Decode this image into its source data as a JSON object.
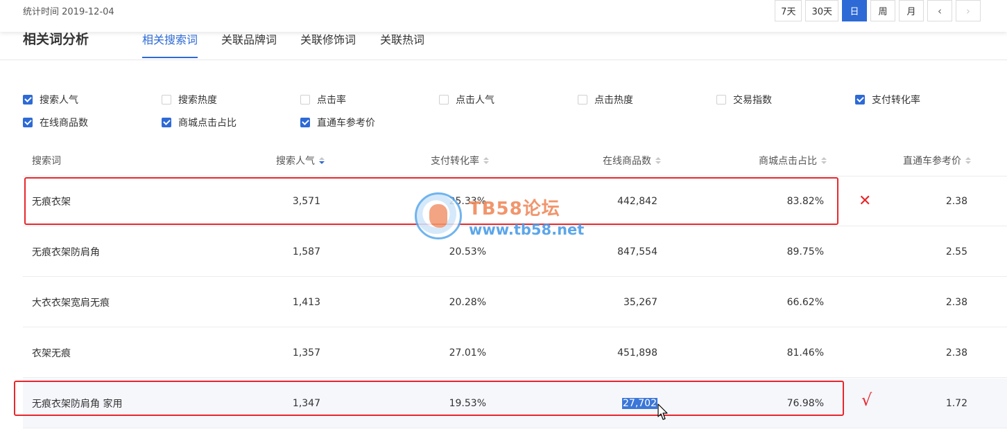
{
  "header": {
    "stat_time": "统计时间 2019-12-04",
    "periods": [
      "7天",
      "30天",
      "日",
      "周",
      "月"
    ],
    "active_period": "日",
    "prev_icon": "‹",
    "next_icon": "›"
  },
  "section": {
    "title": "相关词分析",
    "tabs": [
      "相关搜索词",
      "关联品牌词",
      "关联修饰词",
      "关联热词"
    ],
    "active_tab": "相关搜索词"
  },
  "metrics": [
    {
      "label": "搜索人气",
      "checked": true
    },
    {
      "label": "搜索热度",
      "checked": false
    },
    {
      "label": "点击率",
      "checked": false
    },
    {
      "label": "点击人气",
      "checked": false
    },
    {
      "label": "点击热度",
      "checked": false
    },
    {
      "label": "交易指数",
      "checked": false
    },
    {
      "label": "支付转化率",
      "checked": true
    },
    {
      "label": "在线商品数",
      "checked": true
    },
    {
      "label": "商城点击占比",
      "checked": true
    },
    {
      "label": "直通车参考价",
      "checked": true
    }
  ],
  "table": {
    "headers": [
      "搜索词",
      "搜索人气",
      "支付转化率",
      "在线商品数",
      "商城点击占比",
      "直通车参考价"
    ],
    "rows": [
      [
        "无痕衣架",
        "3,571",
        "25.33%",
        "442,842",
        "83.82%",
        "2.38"
      ],
      [
        "无痕衣架防肩角",
        "1,587",
        "20.53%",
        "847,554",
        "89.75%",
        "2.55"
      ],
      [
        "大衣衣架宽肩无痕",
        "1,413",
        "20.28%",
        "35,267",
        "66.62%",
        "2.38"
      ],
      [
        "衣架无痕",
        "1,357",
        "27.01%",
        "451,898",
        "81.46%",
        "2.38"
      ],
      [
        "无痕衣架防肩角 家用",
        "1,347",
        "19.53%",
        "27,702",
        "76.98%",
        "1.72"
      ]
    ]
  },
  "annotations": {
    "cross": "✕",
    "check": "√",
    "color": "#e8262b"
  },
  "watermark": {
    "title": "TB58论坛",
    "url": "www.tb58.net"
  },
  "colors": {
    "accent": "#2d6ad6"
  }
}
